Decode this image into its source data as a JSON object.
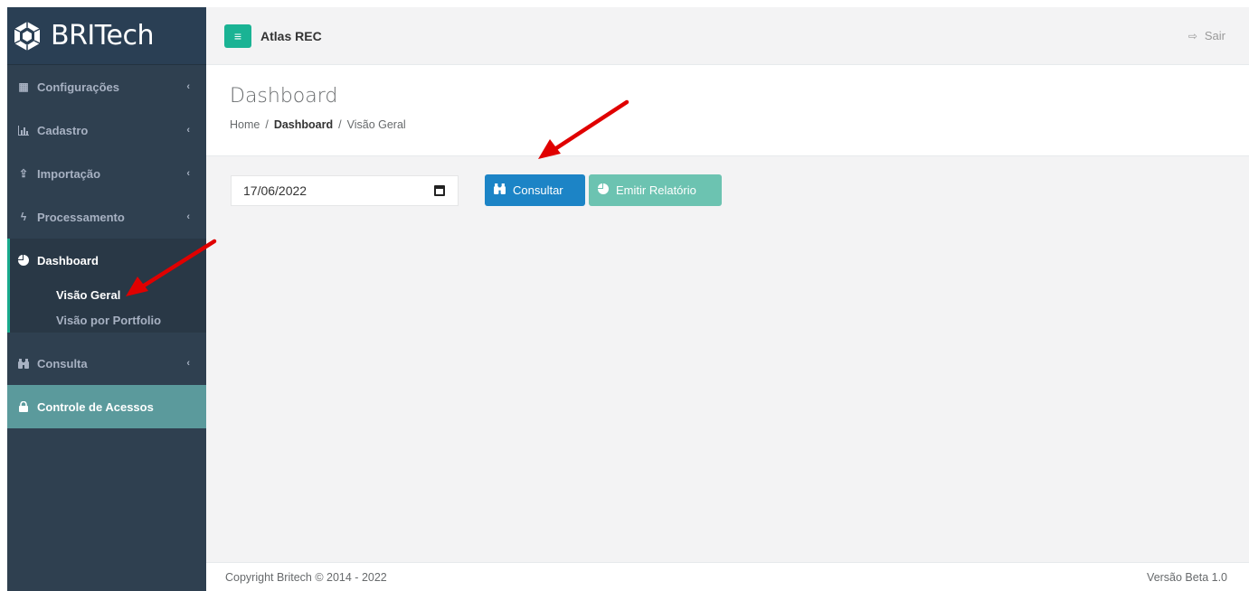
{
  "brand": {
    "name": "BRITech",
    "icon": "cube-logo-icon"
  },
  "sidebar": {
    "items": [
      {
        "label": "Configurações",
        "icon": "th-large-icon"
      },
      {
        "label": "Cadastro",
        "icon": "bar-chart-icon"
      },
      {
        "label": "Importação",
        "icon": "upload-icon"
      },
      {
        "label": "Processamento",
        "icon": "bolt-icon"
      },
      {
        "label": "Dashboard",
        "icon": "pie-chart-icon"
      },
      {
        "label": "Consulta",
        "icon": "binoculars-icon"
      },
      {
        "label": "Controle de Acessos",
        "icon": "lock-icon"
      }
    ],
    "dashboard_sub": [
      {
        "label": "Visão Geral"
      },
      {
        "label": "Visão por Portfolio"
      }
    ]
  },
  "topbar": {
    "title": "Atlas REC",
    "logout_label": "Sair"
  },
  "heading": {
    "title": "Dashboard",
    "breadcrumb": [
      "Home",
      "Dashboard",
      "Visão Geral"
    ]
  },
  "filters": {
    "date_value": "17/06/2022"
  },
  "buttons": {
    "consultar": "Consultar",
    "emitir": "Emitir Relatório"
  },
  "footer": {
    "copyright": "Copyright Britech © 2014 - 2022",
    "version": "Versão Beta 1.0"
  },
  "colors": {
    "sidebar": "#2f4050",
    "accent": "#1ab394",
    "primary": "#1c84c6",
    "highlight": "#5b9a9c",
    "annotation": "#e00000"
  }
}
